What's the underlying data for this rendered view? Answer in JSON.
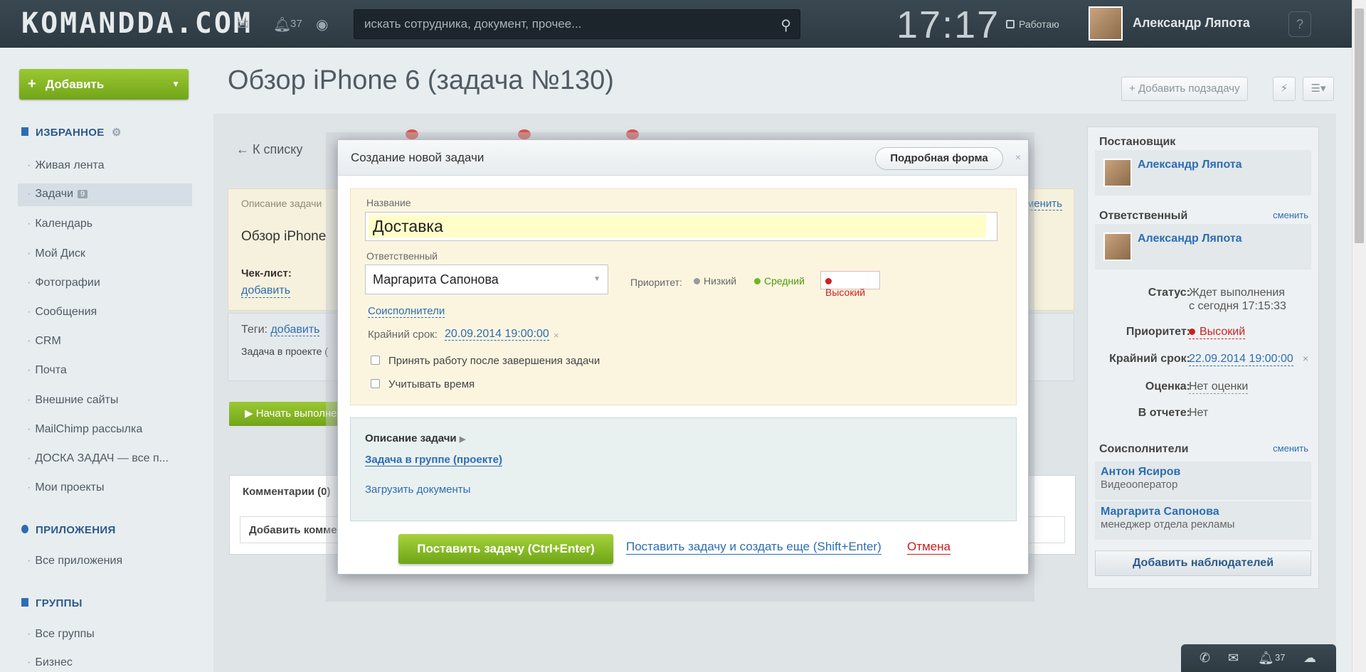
{
  "header": {
    "logo": "KOMANDDA.COM",
    "notifications_count": "37",
    "search_placeholder": "искать сотрудника, документ, прочее...",
    "clock": "17:17",
    "work_status": "Работаю",
    "user_name": "Александр Ляпота",
    "help": "?"
  },
  "sidebar": {
    "add_label": "Добавить",
    "favorites_title": "ИЗБРАННОЕ",
    "items": [
      {
        "label": "Живая лента"
      },
      {
        "label": "Задачи",
        "count": "9"
      },
      {
        "label": "Календарь"
      },
      {
        "label": "Мой Диск"
      },
      {
        "label": "Фотографии"
      },
      {
        "label": "Сообщения"
      },
      {
        "label": "CRM"
      },
      {
        "label": "Почта"
      },
      {
        "label": "Внешние сайты"
      },
      {
        "label": "MailChimp рассылка"
      },
      {
        "label": "ДОСКА ЗАДАЧ — все п..."
      },
      {
        "label": "Мои проекты"
      }
    ],
    "apps_title": "ПРИЛОЖЕНИЯ",
    "apps_items": [
      {
        "label": "Все приложения"
      }
    ],
    "groups_title": "ГРУППЫ",
    "groups_items": [
      {
        "label": "Все группы"
      },
      {
        "label": "Бизнес"
      }
    ]
  },
  "page": {
    "title": "Обзор iPhone 6 (задача №130)",
    "add_subtask": "Добавить подзадачу",
    "back_link": "← К списку",
    "desc_label": "Описание задачи",
    "desc_change": "изменить",
    "task_name": "Обзор iPhone",
    "checklist_label": "Чек-лист:",
    "checklist_add": "добавить",
    "tags_label": "Теги:",
    "tags_add": "добавить",
    "project_text": "Задача в проекте (",
    "start_button": "Начать выполне",
    "comments_tab": "Комментарии (0)",
    "add_comment": "Добавить комме"
  },
  "right_panel": {
    "creator_title": "Постановщик",
    "creator_name": "Александр Ляпота",
    "responsible_title": "Ответственный",
    "responsible_change": "сменить",
    "responsible_name": "Александр Ляпота",
    "status_key": "Статус:",
    "status_val1": "Ждет выполнения",
    "status_val2": "с сегодня 17:15:33",
    "priority_key": "Приоритет:",
    "priority_val": "Высокий",
    "deadline_key": "Крайний срок:",
    "deadline_val": "22.09.2014 19:00:00",
    "deadline_x": "×",
    "rating_key": "Оценка:",
    "rating_val": "Нет оценки",
    "report_key": "В отчете:",
    "report_val": "Нет",
    "coexec_title": "Соисполнители",
    "coexec_change": "сменить",
    "coexecutors": [
      {
        "name": "Антон Ясиров",
        "role": "Видеооператор"
      },
      {
        "name": "Маргарита Сапонова",
        "role": "менеджер отдела рекламы"
      }
    ],
    "add_observers": "Добавить наблюдателей"
  },
  "modal": {
    "title": "Создание новой задачи",
    "full_form": "Подробная форма",
    "close": "×",
    "name_label": "Название",
    "name_value": "Доставка",
    "responsible_label": "Ответственный",
    "responsible_value": "Маргарита Сапонова",
    "priority_label": "Приоритет:",
    "priority_low": "Низкий",
    "priority_mid": "Средний",
    "priority_high": "Высокий",
    "coexecutors_link": "Соисполнители",
    "deadline_label": "Крайний срок:",
    "deadline_value": "20.09.2014 19:00:00",
    "deadline_x": "×",
    "accept_checkbox": "Принять работу после завершения задачи",
    "time_checkbox": "Учитывать время",
    "desc_title": "Описание задачи",
    "group_link": "Задача в группе (проекте)",
    "upload_link": "Загрузить документы",
    "submit": "Поставить задачу (Ctrl+Enter)",
    "submit_more": "Поставить задачу и создать еще (Shift+Enter)",
    "cancel": "Отмена"
  },
  "dock": {
    "count": "37"
  },
  "colors": {
    "accent_green": "#7bb224",
    "link_blue": "#2d6db3",
    "danger_red": "#cc1b1b",
    "header_dark": "#2e3a42"
  }
}
